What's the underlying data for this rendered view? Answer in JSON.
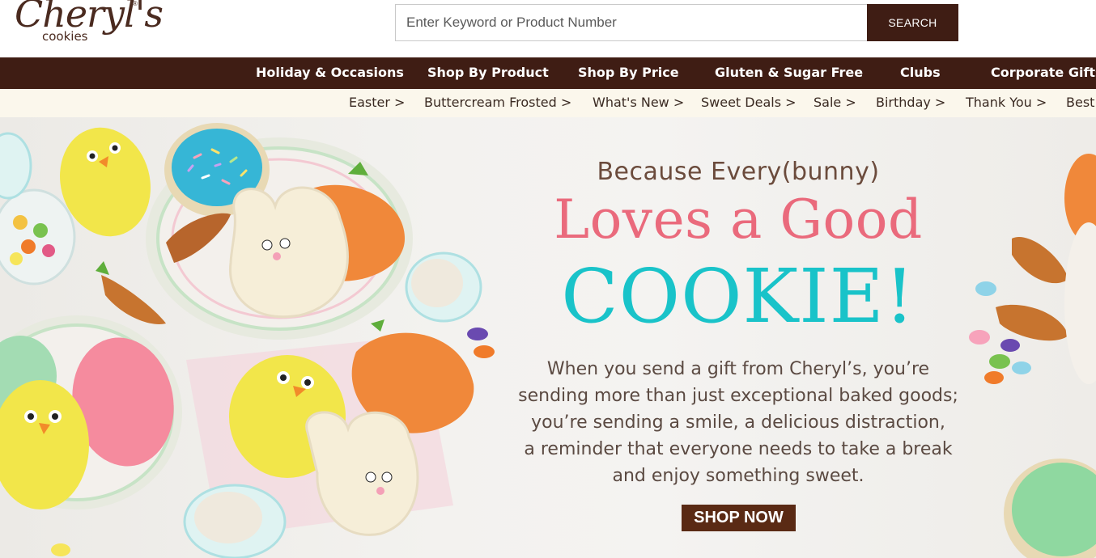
{
  "header": {
    "logo": {
      "name": "Cheryl's",
      "tagline": "cookies",
      "mark": "®"
    },
    "search": {
      "placeholder": "Enter Keyword or Product Number",
      "button_label": "SEARCH"
    }
  },
  "main_nav": [
    "Holiday & Occasions",
    "Shop By Product",
    "Shop By Price",
    "Gluten & Sugar Free",
    "Clubs",
    "Corporate Gifts"
  ],
  "sub_nav": [
    "Easter >",
    "Buttercream Frosted >",
    "What's New >",
    "Sweet Deals >",
    "Sale >",
    "Birthday >",
    "Thank You >",
    "Best"
  ],
  "hero": {
    "line1": "Because Every(bunny)",
    "line2": "Loves a Good",
    "line3": "COOKIE!",
    "body": [
      "When you send a gift from Cheryl’s, you’re",
      "sending more than just exceptional baked goods;",
      "you’re sending a smile, a delicious distraction,",
      "a reminder that everyone needs to take a break",
      "and enjoy something sweet."
    ],
    "cta": "SHOP NOW"
  },
  "colors": {
    "brand_brown": "#3f1d14",
    "subnav_bg": "#fbf7ec",
    "pink_headline": "#ea6a7c",
    "teal_headline": "#19c3c9",
    "cta_bg": "#5a2a14"
  }
}
